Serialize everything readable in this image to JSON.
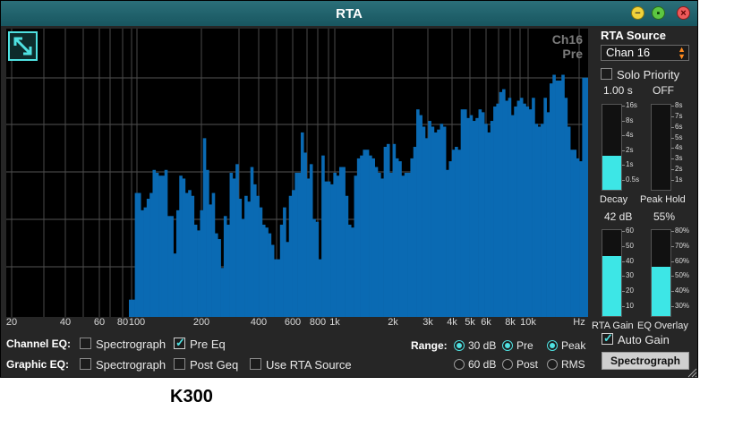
{
  "window": {
    "title": "RTA"
  },
  "plot": {
    "channel_label_line1": "Ch16",
    "channel_label_line2": "Pre",
    "freq_labels": [
      "20",
      "40",
      "60",
      "80",
      "100",
      "200",
      "400",
      "600",
      "800",
      "1k",
      "2k",
      "3k",
      "4k",
      "5k",
      "6k",
      "8k",
      "10k",
      "Hz"
    ],
    "bar_color": "#0a6ab3",
    "bars": [
      0.06,
      0.06,
      0.43,
      0.43,
      0.37,
      0.38,
      0.41,
      0.43,
      0.51,
      0.5,
      0.49,
      0.49,
      0.51,
      0.35,
      0.35,
      0.22,
      0.37,
      0.49,
      0.48,
      0.43,
      0.44,
      0.42,
      0.32,
      0.3,
      0.37,
      0.62,
      0.51,
      0.39,
      0.43,
      0.29,
      0.27,
      0.17,
      0.35,
      0.32,
      0.5,
      0.48,
      0.53,
      0.41,
      0.34,
      0.42,
      0.4,
      0.52,
      0.46,
      0.42,
      0.38,
      0.32,
      0.31,
      0.29,
      0.25,
      0.2,
      0.2,
      0.32,
      0.38,
      0.26,
      0.42,
      0.44,
      0.5,
      0.5,
      0.64,
      0.57,
      0.48,
      0.53,
      0.34,
      0.33,
      0.2,
      0.56,
      0.47,
      0.47,
      0.46,
      0.5,
      0.49,
      0.52,
      0.52,
      0.42,
      0.32,
      0.31,
      0.49,
      0.55,
      0.56,
      0.58,
      0.58,
      0.56,
      0.55,
      0.52,
      0.5,
      0.48,
      0.59,
      0.6,
      0.5,
      0.6,
      0.55,
      0.54,
      0.49,
      0.5,
      0.5,
      0.55,
      0.59,
      0.72,
      0.7,
      0.66,
      0.62,
      0.68,
      0.66,
      0.64,
      0.65,
      0.67,
      0.66,
      0.51,
      0.54,
      0.58,
      0.59,
      0.58,
      0.72,
      0.72,
      0.69,
      0.7,
      0.68,
      0.69,
      0.72,
      0.71,
      0.67,
      0.64,
      0.68,
      0.73,
      0.74,
      0.78,
      0.79,
      0.75,
      0.76,
      0.7,
      0.73,
      0.75,
      0.76,
      0.74,
      0.73,
      0.72,
      0.76,
      0.67,
      0.66,
      0.67,
      0.76,
      0.71,
      0.81,
      0.84,
      0.82,
      0.82,
      0.84,
      0.76,
      0.66,
      0.58,
      0.58,
      0.55,
      0.54,
      0.83,
      0.83
    ]
  },
  "side_panel": {
    "rta_source_label": "RTA Source",
    "source_value": "Chan 16",
    "solo_priority_label": "Solo Priority",
    "solo_priority_checked": false,
    "decay_value": "1.00 s",
    "peak_hold_value": "OFF",
    "decay_ticks": [
      "16s",
      "8s",
      "4s",
      "2s",
      "1s",
      "0.5s"
    ],
    "peak_hold_ticks": [
      "8s",
      "7s",
      "6s",
      "5s",
      "4s",
      "3s",
      "2s",
      "1s"
    ],
    "decay_level": 0.4,
    "peak_hold_level": 0.0,
    "decay_label": "Decay",
    "peak_hold_label": "Peak Hold",
    "rta_gain_value": "42 dB",
    "eq_overlay_value": "55%",
    "rta_gain_ticks": [
      "60",
      "50",
      "40",
      "30",
      "20",
      "10"
    ],
    "eq_overlay_ticks": [
      "80%",
      "70%",
      "60%",
      "50%",
      "40%",
      "30%"
    ],
    "rta_gain_level": 0.7,
    "eq_overlay_level": 0.57,
    "rta_gain_label": "RTA Gain",
    "eq_overlay_label": "EQ Overlay",
    "auto_gain_label": "Auto Gain",
    "auto_gain_checked": true,
    "accent_color": "#3de6e6"
  },
  "bottom": {
    "channel_eq_label": "Channel EQ:",
    "graphic_eq_label": "Graphic EQ:",
    "ch_spectrograph_label": "Spectrograph",
    "ch_spectrograph_checked": false,
    "pre_eq_label": "Pre Eq",
    "pre_eq_checked": true,
    "geq_spectrograph_label": "Spectrograph",
    "geq_spectrograph_checked": false,
    "post_geq_label": "Post Geq",
    "post_geq_checked": false,
    "use_rta_source_label": "Use RTA Source",
    "use_rta_source_checked": false,
    "range_label": "Range:",
    "range_30": "30 dB",
    "range_60": "60 dB",
    "range_selected": "30 dB",
    "pre_label": "Pre",
    "post_label": "Post",
    "tap_selected": "Pre",
    "peak_label": "Peak",
    "rms_label": "RMS",
    "detector_selected": "Peak",
    "spectrograph_button": "Spectrograph"
  },
  "caption": "K300"
}
